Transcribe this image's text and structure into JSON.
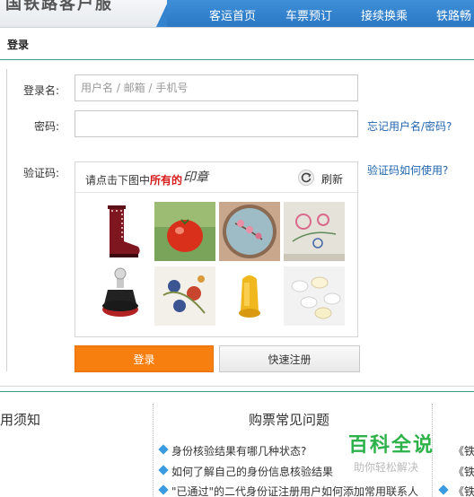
{
  "header": {
    "logo_text": "国铁路客户服",
    "nav": [
      "客运首页",
      "车票预订",
      "接续换乘",
      "铁路畅"
    ]
  },
  "login": {
    "section_title": "登录",
    "username_label": "登录名:",
    "username_placeholder": "用户名 / 邮箱 / 手机号",
    "password_label": "密码:",
    "forgot_link": "忘记用户名/密码?",
    "captcha_label": "验证码:",
    "captcha_help_link": "验证码如何使用?",
    "captcha": {
      "prompt_prefix": "请点击下图中",
      "prompt_highlight": "所有的",
      "prompt_glyph": "印章",
      "refresh_label": "刷新",
      "tiles": [
        "red rubber boot",
        "red tomato",
        "embroidered flowers hoop",
        "embroidered flowers cloth",
        "round seal stamp",
        "floral porcelain plate",
        "yellow stone seal",
        "white pills"
      ]
    },
    "login_button": "登录",
    "register_button": "快速注册"
  },
  "bottom": {
    "notice_title": "用须知",
    "faq_title": "购票常见问题",
    "faq_items": [
      "身份核验结果有哪几种状态?",
      "如何了解自己的身份信息核验结果",
      "\"已通过\"的二代身份证注册用户如何添加常用联系人"
    ],
    "right_items": [
      "《铁",
      "《铁",
      "《铁"
    ]
  },
  "watermark": {
    "main": "百科全说",
    "sub": "助你轻松解决"
  },
  "colors": {
    "nav_blue": "#2f80cc",
    "login_orange": "#f67f10",
    "link_blue": "#2166b0",
    "highlight_red": "#d61b1b",
    "divider_teal": "#3d9a8c"
  }
}
